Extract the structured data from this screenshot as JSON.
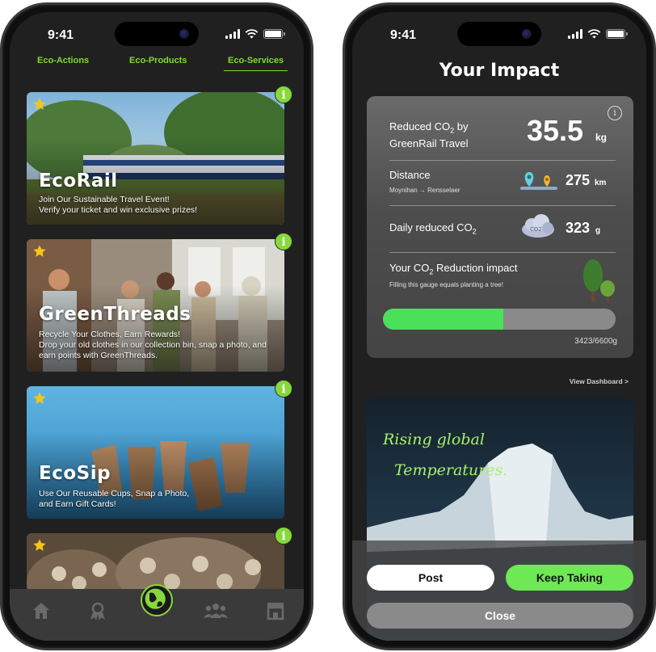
{
  "status": {
    "time": "9:41"
  },
  "left_phone": {
    "tabs": [
      "Eco-Actions",
      "Eco-Products",
      "Eco-Services"
    ],
    "active_tab": "Eco-Services",
    "cards": [
      {
        "title": "EcoRail",
        "desc_line1": "Join Our Sustainable Travel Event!",
        "desc_line2": "Verify your ticket and win exclusive prizes!"
      },
      {
        "title": "GreenThreads",
        "desc_line1": "Recycle Your Clothes, Earn Rewards!",
        "desc_line2": "Drop your old clothes in our collection bin, snap a photo, and earn points with GreenThreads."
      },
      {
        "title": "EcoSip",
        "desc_line1": "Use Our Reusable Cups, Snap a Photo,",
        "desc_line2": "and Earn Gift Cards!"
      }
    ],
    "info_glyph": "i",
    "nav": [
      "home-icon",
      "achievements-icon",
      "earth-icon",
      "community-icon",
      "store-icon"
    ]
  },
  "right_phone": {
    "title": "Your Impact",
    "reduced_label_a": "Reduced CO",
    "reduced_label_sub": "2",
    "reduced_label_b": " by",
    "reduced_label_c": "GreenRail Travel",
    "reduced_value": "35.5",
    "reduced_unit": "kg",
    "distance_label": "Distance",
    "route": "Moynihan → Rensselaer",
    "distance_value": "275",
    "distance_unit": "km",
    "daily_label": "Daily reduced CO",
    "daily_sub": "2",
    "daily_value": "323",
    "daily_unit": "g",
    "impact_label_a": "Your CO",
    "impact_label_sub": "2",
    "impact_label_b": " Reduction impact",
    "impact_note": "Filling this gauge equals planting a tree!",
    "gauge_fraction": 0.5186,
    "gauge_text": "3423/6600g",
    "info_glyph": "i",
    "dashboard_link": "View Dashboard  >",
    "photo_text_1": "Rising global",
    "photo_text_2": "Temperatures.",
    "post_label": "Post",
    "keep_label": "Keep Taking",
    "close_label": "Close"
  },
  "colors": {
    "accent": "#86d93a",
    "gauge": "#4be05a",
    "keep_button": "#6ee855"
  }
}
